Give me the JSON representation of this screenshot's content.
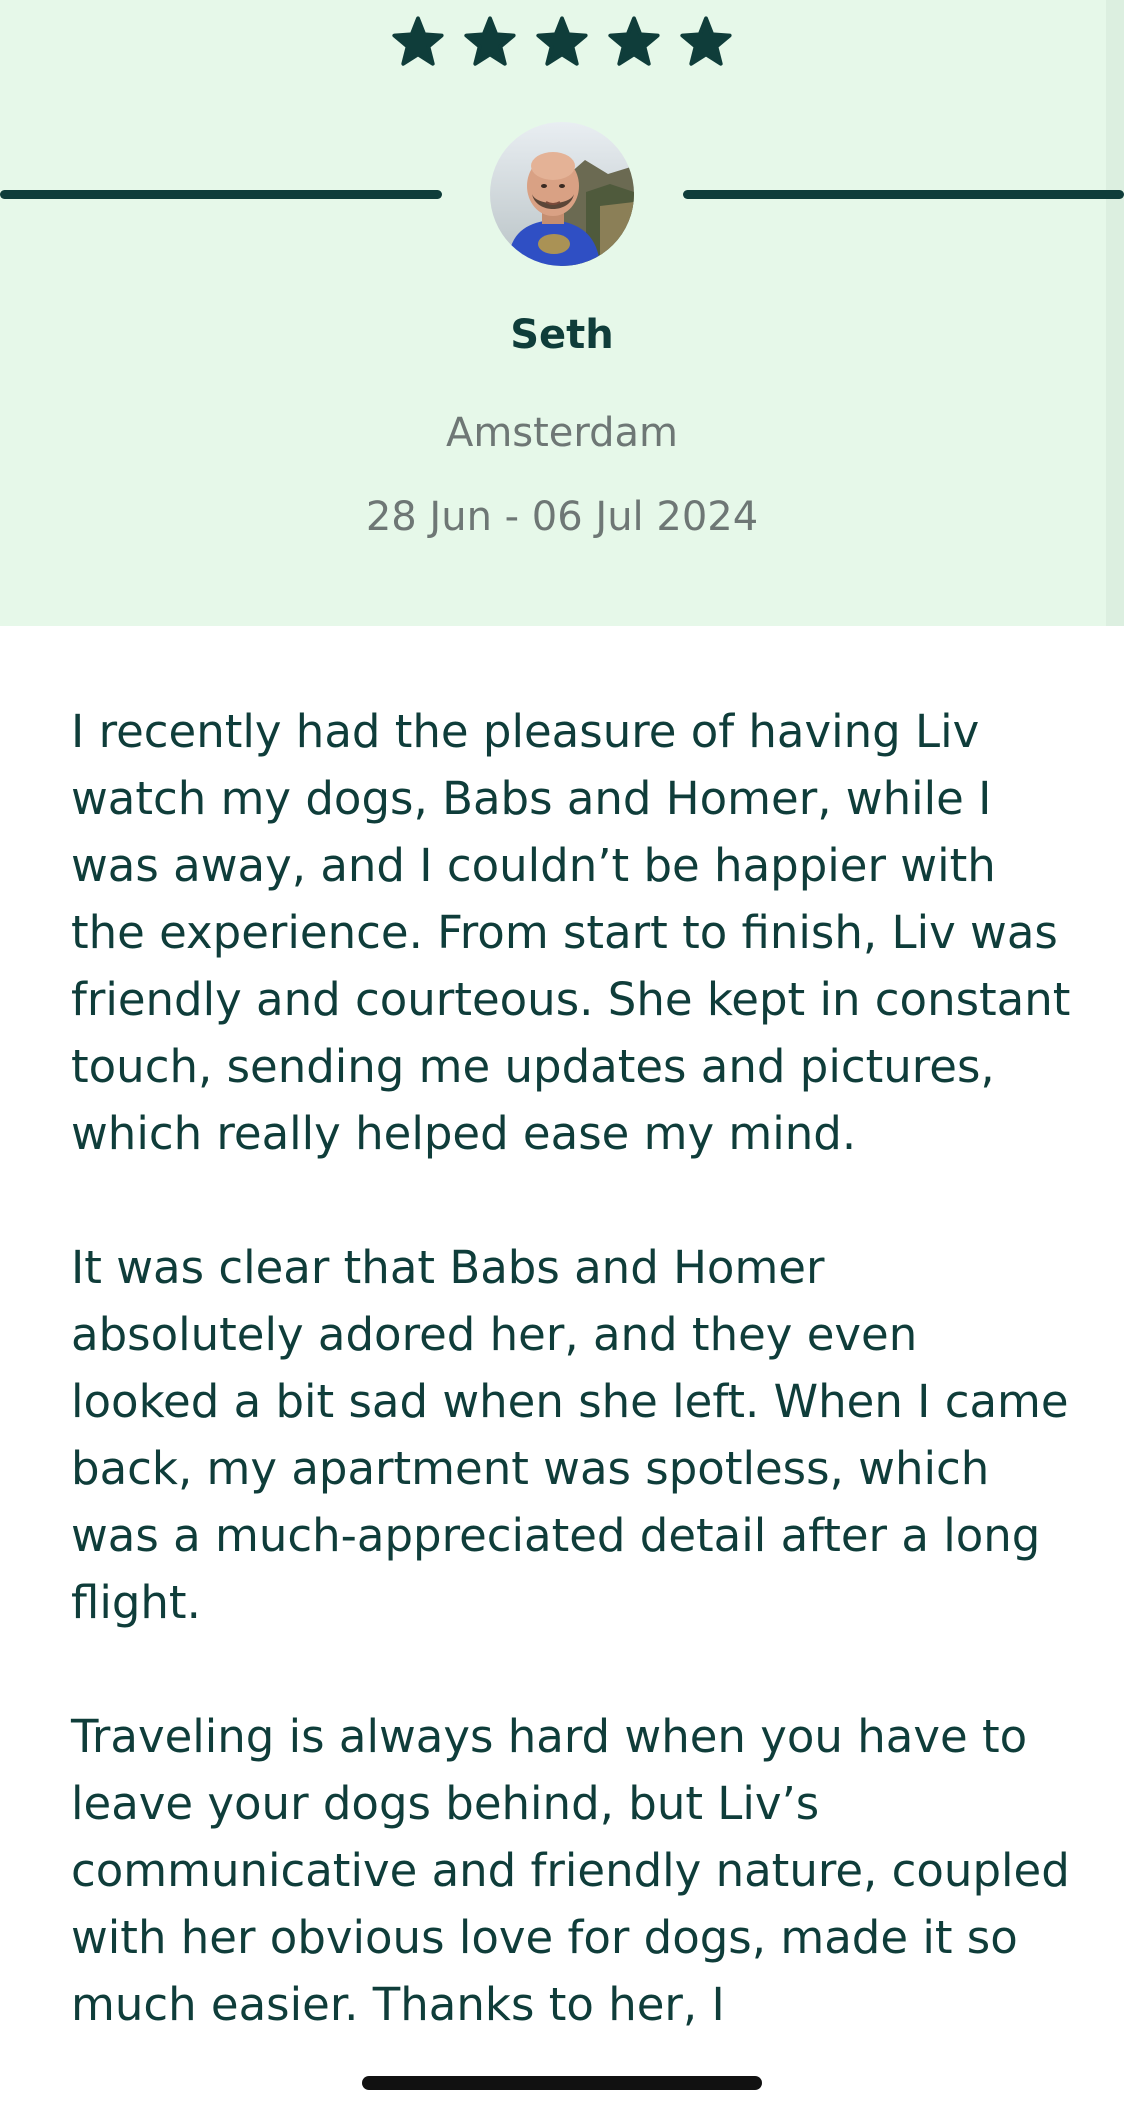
{
  "review": {
    "rating": 5,
    "rating_max": 5,
    "reviewer": {
      "name": "Seth",
      "location": "Amsterdam",
      "dates": "28 Jun - 06 Jul 2024"
    },
    "paragraphs": [
      "I recently had the pleasure of having Liv watch my dogs, Babs and Homer, while I was away, and I couldn’t be happier with the experience. From start to finish, Liv was friendly and courteous. She kept in constant touch, sending me updates and pictures, which really helped ease my mind.",
      "It was clear that Babs and Homer absolutely adored her, and they even looked a bit sad when she left. When I came back, my apartment was spotless, which was a much-appreciated detail after a long flight.",
      "Traveling is always hard when you have to leave your dogs behind, but Liv’s communicative and friendly nature, coupled with her obvious love for dogs, made it so much easier. Thanks to her, I"
    ]
  },
  "icons": {
    "star": "star-icon",
    "avatar": "avatar"
  },
  "colors": {
    "header_bg": "#e6f8e9",
    "primary_text": "#0f3d3a",
    "secondary_text": "#6e7775",
    "star": "#0f3d3a"
  }
}
